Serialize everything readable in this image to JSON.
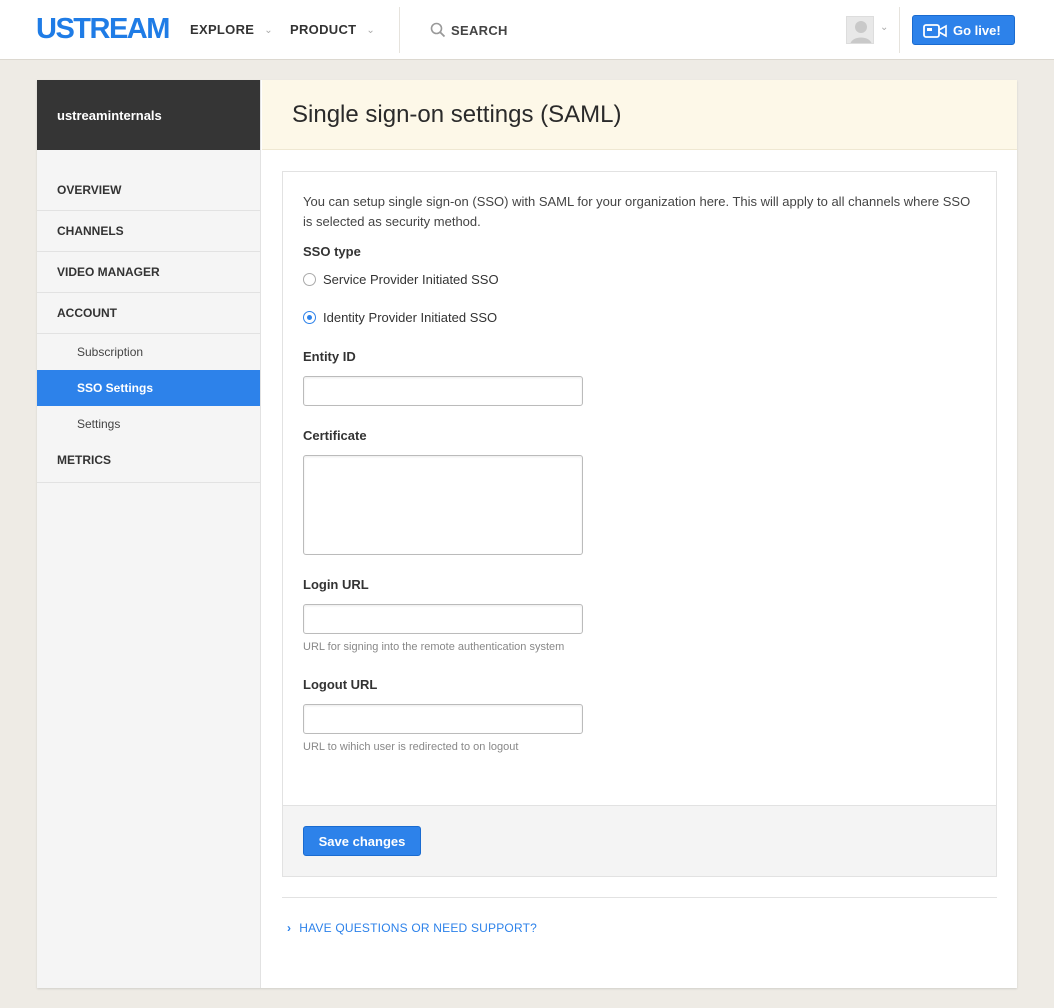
{
  "header": {
    "logo": "USTREAM",
    "nav": [
      {
        "label": "EXPLORE"
      },
      {
        "label": "PRODUCT"
      }
    ],
    "search_label": "SEARCH",
    "go_live_label": "Go live!"
  },
  "sidebar": {
    "account_name": "ustreaminternals",
    "items": {
      "overview": "OVERVIEW",
      "channels": "CHANNELS",
      "video_manager": "VIDEO MANAGER",
      "account": "ACCOUNT",
      "subscription": "Subscription",
      "sso_settings": "SSO Settings",
      "settings": "Settings",
      "metrics": "METRICS"
    },
    "active_item": "SSO Settings"
  },
  "main": {
    "title": "Single sign-on settings (SAML)",
    "intro": "You can setup single sign-on (SSO) with SAML for your organization here. This will apply to all channels where SSO is selected as security method.",
    "sso_type_label": "SSO type",
    "sso_options": [
      {
        "label": "Service Provider Initiated SSO",
        "selected": false
      },
      {
        "label": "Identity Provider Initiated SSO",
        "selected": true
      }
    ],
    "entity_id": {
      "label": "Entity ID",
      "value": ""
    },
    "certificate": {
      "label": "Certificate",
      "value": ""
    },
    "login_url": {
      "label": "Login URL",
      "value": "",
      "help": "URL for signing into the remote authentication system"
    },
    "logout_url": {
      "label": "Logout URL",
      "value": "",
      "help": "URL to wihich user is redirected to on logout"
    },
    "save_label": "Save changes",
    "support_link": "HAVE QUESTIONS OR NEED SUPPORT?"
  },
  "colors": {
    "accent": "#2d82ea",
    "header_bg": "#fdf8e8",
    "sidebar_head_bg": "#353535",
    "page_bg": "#eeebe5"
  }
}
